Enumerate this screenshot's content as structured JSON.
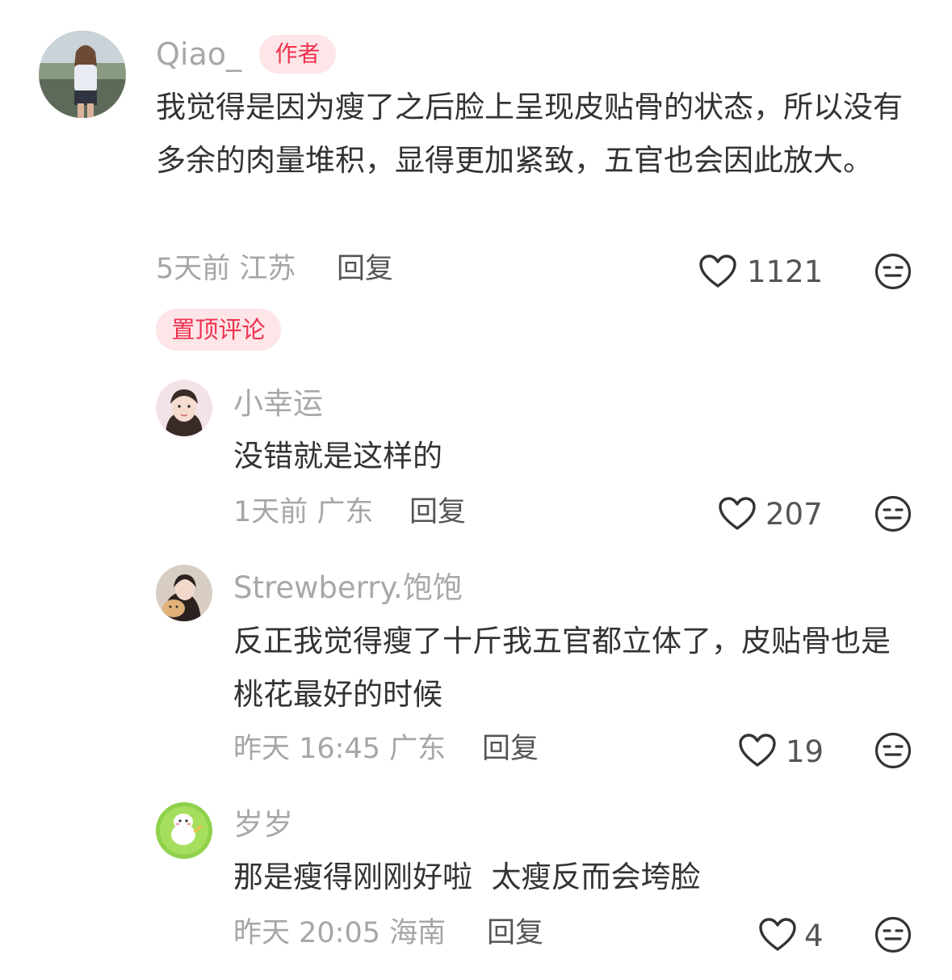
{
  "comment": {
    "username": "Qiao_",
    "author_tag": "作者",
    "text": "我觉得是因为瘦了之后脸上呈现皮贴骨的状态，所以没有多余的肉量堆积，显得更加紧致，五官也会因此放大。",
    "time": "5天前",
    "location": "江苏",
    "reply_label": "回复",
    "likes": "1121",
    "pinned_tag": "置顶评论"
  },
  "replies": [
    {
      "username": "小幸运",
      "text": "没错就是这样的",
      "time": "1天前",
      "location": "广东",
      "reply_label": "回复",
      "likes": "207"
    },
    {
      "username": "Strewberry.饱饱",
      "text": "反正我觉得瘦了十斤我五官都立体了，皮贴骨也是桃花最好的时候",
      "time": "昨天 16:45",
      "location": "广东",
      "reply_label": "回复",
      "likes": "19"
    },
    {
      "username": "岁岁",
      "text": "那是瘦得刚刚好啦  太瘦反而会垮脸",
      "time": "昨天 20:05",
      "location": "海南",
      "reply_label": "回复",
      "likes": "4"
    }
  ],
  "icons": {
    "like": "heart-outline-icon",
    "dislike": "meh-face-icon"
  },
  "colors": {
    "accent": "#f0324f",
    "tag_bg": "#fde5e8",
    "muted": "#a6a6a6",
    "text": "#333333"
  }
}
